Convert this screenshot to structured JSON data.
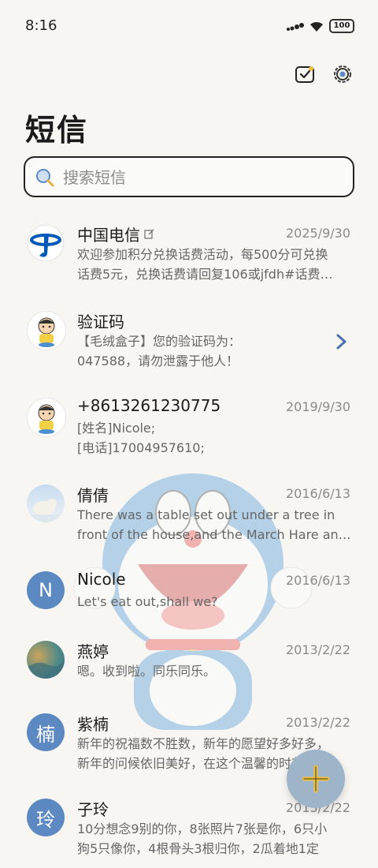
{
  "status_bar": {
    "time": "8:16",
    "battery": "100"
  },
  "toolbar": {
    "mark_read_icon": "check-clipboard-icon",
    "settings_icon": "gear-icon"
  },
  "page_title": "短信",
  "search": {
    "placeholder": "搜索短信",
    "value": ""
  },
  "messages": [
    {
      "sender": "中国电信",
      "date": "2025/9/30",
      "line1": "欢迎参加积分兑换话费活动，每500分可兑换",
      "line2": "话费5元，兑换话费请回复106或jfdh#话费…",
      "avatar": "china-telecom-logo",
      "badge": "edit-icon"
    },
    {
      "sender": "验证码",
      "date": "",
      "line1": "【毛绒盒子】您的验证码为：",
      "line2": "047588，请勿泄露于他人！",
      "avatar": "cartoon-boy"
    },
    {
      "sender": "+8613261230775",
      "date": "2019/9/30",
      "line1": "[姓名]Nicole;",
      "line2": "[电话]17004957610;",
      "avatar": "cartoon-boy"
    },
    {
      "sender": "倩倩",
      "date": "2016/6/13",
      "line1": "There was a table set out under a tree in",
      "line2": "front of the house,and the March Hare an…",
      "avatar": "polar-bear-photo"
    },
    {
      "sender": "Nicole",
      "date": "2016/6/13",
      "line1": "Let's eat out,shall we?",
      "line2": "",
      "avatar_letter": "N"
    },
    {
      "sender": "燕婷",
      "date": "2013/2/22",
      "line1": "嗯。收到啦。同乐同乐。",
      "line2": "",
      "avatar": "landscape-photo"
    },
    {
      "sender": "紫楠",
      "date": "2013/2/22",
      "line1": "新年的祝福数不胜数，新年的愿望好多好多，",
      "line2": "新年的问候依旧美好，在这个温馨的时刻…",
      "avatar_letter": "楠"
    },
    {
      "sender": "子玲",
      "date": "2013/2/22",
      "line1": "10分想念9别的你，8张照片7张是你，6只小",
      "line2": "狗5只像你，4根骨头3根归你，2瓜着地1定",
      "avatar_letter": "玲"
    }
  ],
  "fab": {
    "icon": "plus-icon"
  },
  "colors": {
    "accent": "#5d89c2",
    "fab": "#9db4c9",
    "background": "#f7f6f3"
  }
}
